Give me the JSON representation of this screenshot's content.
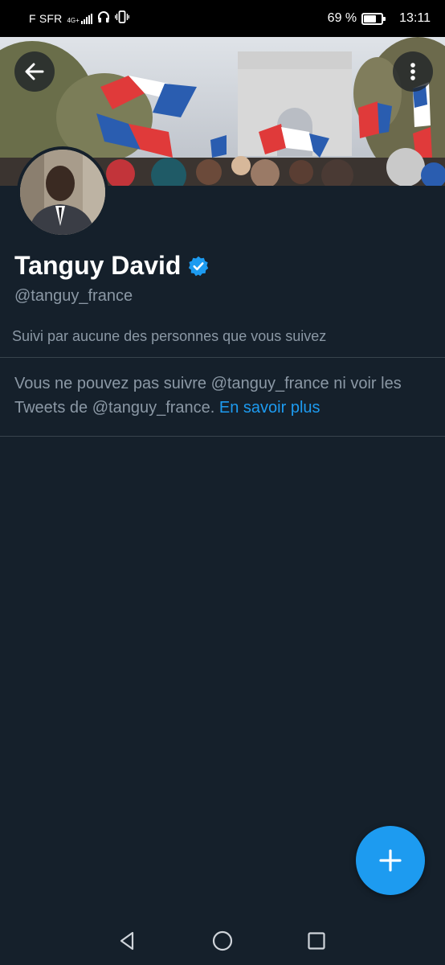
{
  "status_bar": {
    "carrier": "F SFR",
    "network": "4G+",
    "battery": "69 %",
    "battery_level": 0.69,
    "time": "13:11",
    "icons": [
      "signal-icon",
      "headphones-icon",
      "vibrate-icon",
      "battery-icon"
    ]
  },
  "header": {
    "back_icon": "arrow-left-icon",
    "menu_icon": "more-vertical-icon",
    "banner_image": "crowd-with-french-flags-arc-de-triomphe"
  },
  "profile": {
    "name": "Tanguy David",
    "verified_icon": "verified-badge-icon",
    "handle": "@tanguy_france",
    "followed_by": "Suivi par aucune des personnes que vous suivez"
  },
  "notice": {
    "text": "Vous ne pouvez pas suivre @tanguy_france ni voir les Tweets de @tanguy_france.",
    "link": "En savoir plus"
  },
  "fab": {
    "icon": "plus-icon"
  },
  "nav": {
    "icons": [
      "back-triangle-icon",
      "home-circle-icon",
      "recents-square-icon"
    ]
  },
  "colors": {
    "background": "#15202b",
    "accent": "#1d9bf0",
    "secondary_text": "#8b98a5",
    "divider": "#38444d"
  }
}
